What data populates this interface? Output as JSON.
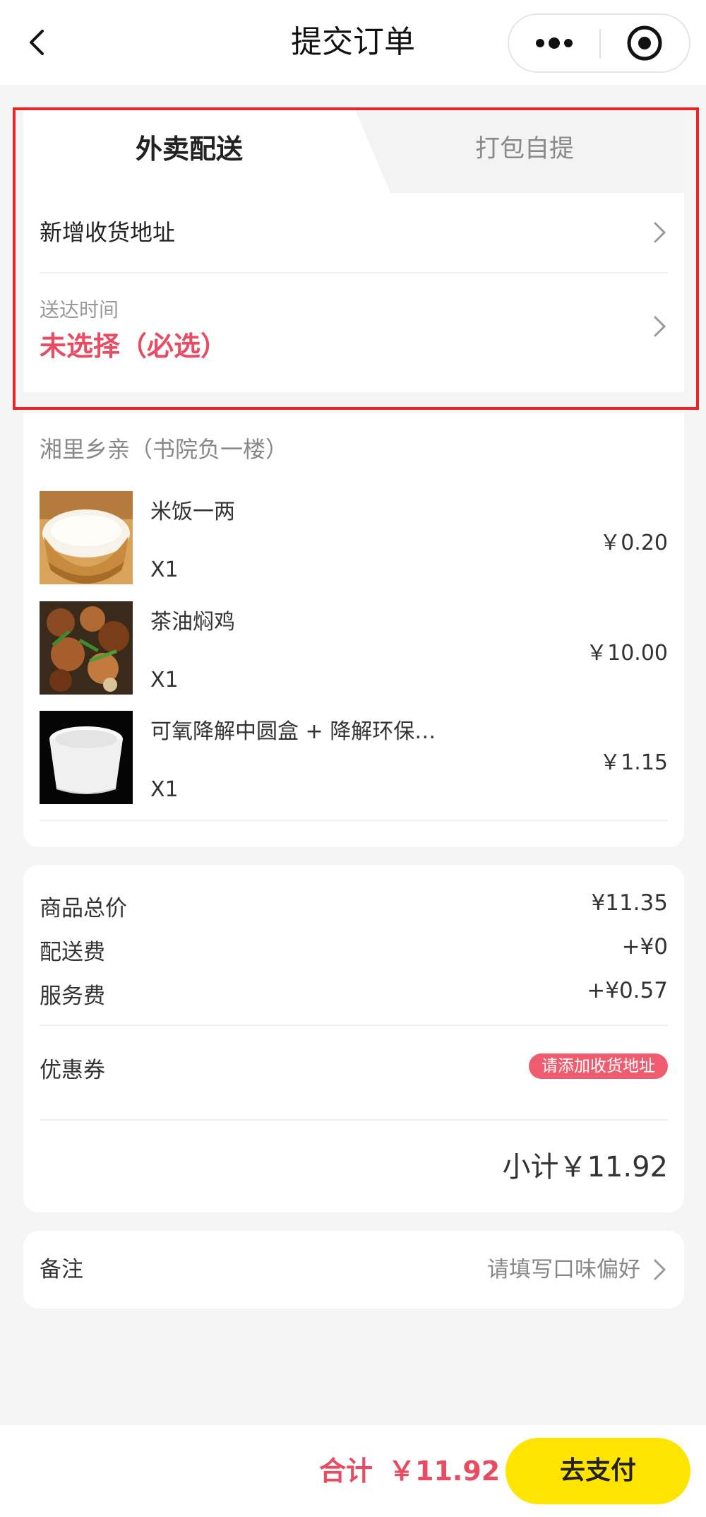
{
  "header": {
    "title": "提交订单",
    "back_icon": "chevron-left-icon",
    "more_icon": "more-dots-icon",
    "close_icon": "target-circle-icon"
  },
  "delivery": {
    "tabs": [
      {
        "label": "外卖配送",
        "active": true
      },
      {
        "label": "打包自提",
        "active": false
      }
    ],
    "add_address_label": "新增收货地址",
    "time_label": "送达时间",
    "time_value": "未选择（必选）"
  },
  "order": {
    "store_name": "湘里乡亲（书院负一楼）",
    "items": [
      {
        "name": "米饭一两",
        "qty": "X1",
        "price": "￥0.20",
        "thumb": "rice-bowl-image"
      },
      {
        "name": "茶油焖鸡",
        "qty": "X1",
        "price": "￥10.00",
        "thumb": "braised-chicken-image"
      },
      {
        "name": "可氧降解中圆盒 + 降解环保…",
        "qty": "X1",
        "price": "￥1.15",
        "thumb": "white-container-image"
      }
    ]
  },
  "summary": {
    "goods_total_label": "商品总价",
    "goods_total_value": "¥11.35",
    "delivery_fee_label": "配送费",
    "delivery_fee_value": "+¥0",
    "service_fee_label": "服务费",
    "service_fee_value": "+¥0.57",
    "coupon_label": "优惠券",
    "coupon_badge": "请添加收货地址",
    "subtotal": "小计￥11.92"
  },
  "remark": {
    "label": "备注",
    "placeholder": "请填写口味偏好"
  },
  "footer": {
    "total_label": "合计",
    "total_amount": "￥11.92",
    "pay_button": "去支付"
  },
  "colors": {
    "accent_red": "#e84c62",
    "pay_yellow": "#ffe400",
    "highlight_border": "#e8262a"
  }
}
